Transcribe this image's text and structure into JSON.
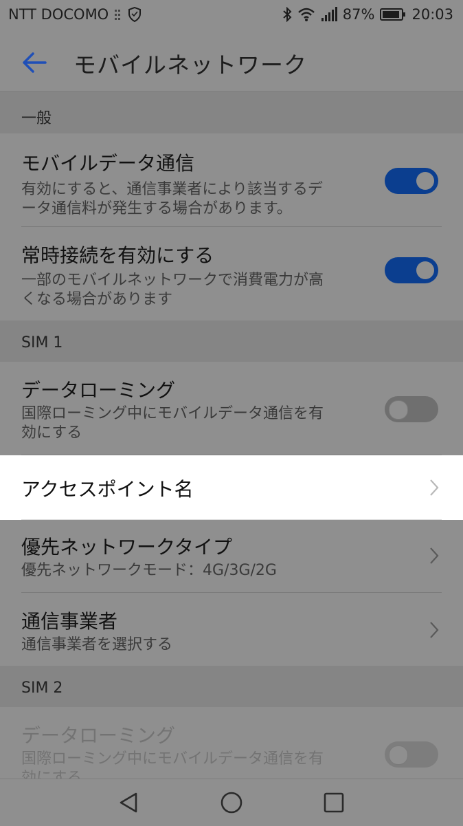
{
  "status_bar": {
    "carrier": "NTT DOCOMO",
    "battery": "87%",
    "time": "20:03",
    "icons": [
      "sim-icon",
      "shield-icon",
      "bluetooth-icon",
      "wifi-icon",
      "signal-icon",
      "battery-icon"
    ]
  },
  "appbar": {
    "title": "モバイルネットワーク",
    "back_icon": "arrow-left-icon",
    "accent": "#1f4fb7"
  },
  "sections": {
    "general": "一般",
    "sim1": "SIM 1",
    "sim2": "SIM 2"
  },
  "rows": {
    "mobile_data": {
      "title": "モバイルデータ通信",
      "subtitle_line1": "有効にすると、通信事業者により該当するデ",
      "subtitle_line2": "ータ通信料が発生する場合があります。",
      "toggle": "on"
    },
    "always_on": {
      "title": "常時接続を有効にする",
      "subtitle_line1": "一部のモバイルネットワークで消費電力が高",
      "subtitle_line2": "くなる場合があります",
      "toggle": "on"
    },
    "roaming_sim1": {
      "title": "データローミング",
      "subtitle_line1": "国際ローミング中にモバイルデータ通信を有",
      "subtitle_line2": "効にする",
      "toggle": "off"
    },
    "apn": {
      "title": "アクセスポイント名"
    },
    "preferred_network": {
      "title": "優先ネットワークタイプ",
      "subtitle": "優先ネットワークモード：4G/3G/2G"
    },
    "carrier": {
      "title": "通信事業者",
      "subtitle": "通信事業者を選択する"
    },
    "roaming_sim2": {
      "title": "データローミング",
      "subtitle_line1": "国際ローミング中にモバイルデータ通信を有",
      "subtitle_line2": "効にする",
      "toggle": "off",
      "disabled": true
    }
  },
  "navbar": {
    "icons": [
      "back-triangle-icon",
      "home-circle-icon",
      "recents-square-icon"
    ]
  }
}
